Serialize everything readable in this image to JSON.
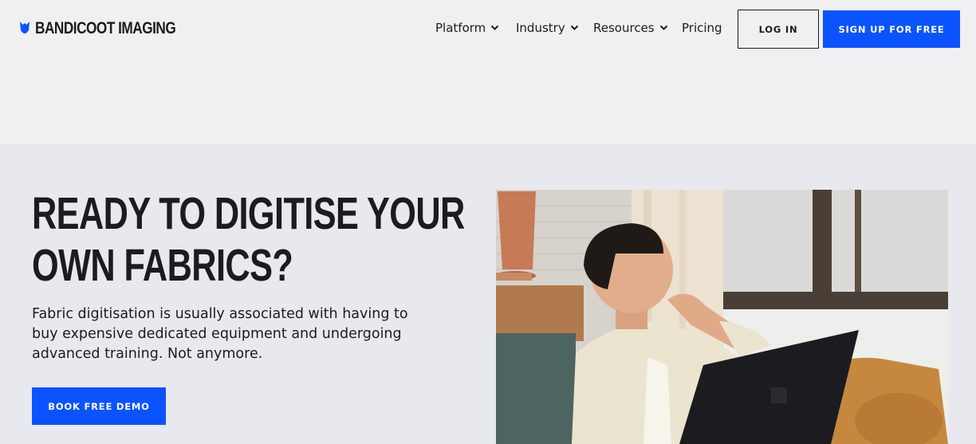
{
  "header": {
    "brand": "BANDICOOT IMAGING",
    "nav": [
      {
        "label": "Platform",
        "has_dropdown": true
      },
      {
        "label": "Industry",
        "has_dropdown": true
      },
      {
        "label": "Resources",
        "has_dropdown": true
      },
      {
        "label": "Pricing",
        "has_dropdown": false
      }
    ],
    "login_label": "LOG IN",
    "signup_label": "SIGN UP FOR FREE"
  },
  "hero": {
    "title_line1": "READY TO DIGITISE YOUR",
    "title_line2": "OWN FABRICS?",
    "text": "Fabric digitisation is usually associated with having to buy expensive dedicated equipment and undergoing advanced training. Not anymore.",
    "cta_label": "BOOK FREE DEMO",
    "image_icon": "photo-man-with-laptop"
  },
  "colors": {
    "accent": "#0a53ff",
    "text": "#1c1c1e",
    "header_bg": "#f0f0f3",
    "hero_bg": "#e8e9ee"
  }
}
